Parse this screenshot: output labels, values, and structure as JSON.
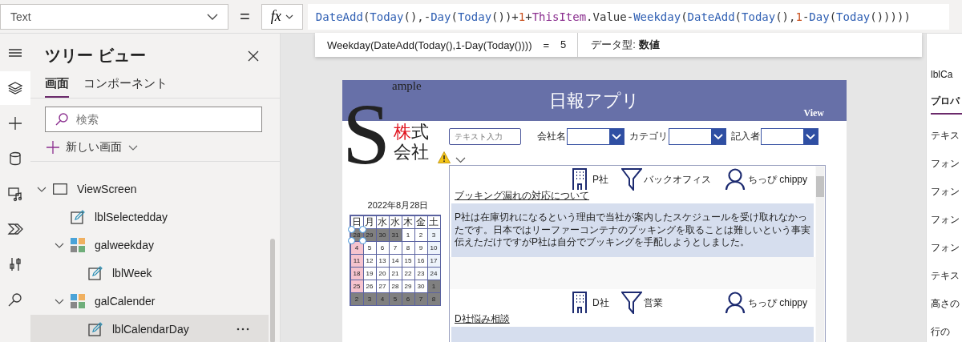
{
  "property_select": {
    "value": "Text"
  },
  "equals": "=",
  "fx_label": "fx",
  "formula": [
    {
      "kind": "function",
      "text": "DateAdd"
    },
    {
      "kind": "punct",
      "text": "("
    },
    {
      "kind": "function",
      "text": "Today"
    },
    {
      "kind": "punct",
      "text": "(),-"
    },
    {
      "kind": "function",
      "text": "Day"
    },
    {
      "kind": "punct",
      "text": "("
    },
    {
      "kind": "function",
      "text": "Today"
    },
    {
      "kind": "punct",
      "text": "())+"
    },
    {
      "kind": "number",
      "text": "1"
    },
    {
      "kind": "punct",
      "text": "+"
    },
    {
      "kind": "keyword",
      "text": "ThisItem"
    },
    {
      "kind": "punct",
      "text": ".Value-"
    },
    {
      "kind": "function",
      "text": "Weekday"
    },
    {
      "kind": "punct",
      "text": "("
    },
    {
      "kind": "function",
      "text": "DateAdd"
    },
    {
      "kind": "punct",
      "text": "("
    },
    {
      "kind": "function",
      "text": "Today"
    },
    {
      "kind": "punct",
      "text": "(),"
    },
    {
      "kind": "number",
      "text": "1"
    },
    {
      "kind": "punct",
      "text": "-"
    },
    {
      "kind": "function",
      "text": "Day"
    },
    {
      "kind": "punct",
      "text": "("
    },
    {
      "kind": "function",
      "text": "Today"
    },
    {
      "kind": "punct",
      "text": "()))))"
    }
  ],
  "formula_hint": {
    "expression": "Weekday(DateAdd(Today(),1-Day(Today())))",
    "equals": "=",
    "result": "5",
    "data_type": "データ型: **数値**"
  },
  "rail": [
    {
      "kind": "menu",
      "selected": false
    },
    {
      "kind": "layers",
      "selected": true
    },
    {
      "kind": "plus",
      "selected": false
    },
    {
      "kind": "database",
      "selected": false
    },
    {
      "kind": "media",
      "selected": false
    },
    {
      "kind": "flow",
      "selected": false
    },
    {
      "kind": "tools",
      "selected": false
    },
    {
      "kind": "search",
      "selected": false
    }
  ],
  "tree_panel": {
    "title": "ツリー ビュー",
    "tabs": [
      {
        "label": "画面",
        "selected": true
      },
      {
        "label": "コンポーネント",
        "selected": false
      }
    ],
    "search": {
      "placeholder": "検索"
    },
    "new_screen": "新しい画面",
    "items": [
      {
        "label": "ViewScreen",
        "kind": "screen",
        "expanded": true,
        "selected": false,
        "children": [
          {
            "label": "lblSelectedday",
            "kind": "label",
            "selected": false
          },
          {
            "label": "galweekday",
            "kind": "gallery",
            "expanded": true,
            "selected": false,
            "children": [
              {
                "label": "lblWeek",
                "kind": "label",
                "selected": false
              }
            ]
          },
          {
            "label": "galCalender",
            "kind": "gallery",
            "expanded": true,
            "selected": false,
            "children": [
              {
                "label": "lblCalendarDay",
                "kind": "label",
                "selected": true
              }
            ]
          }
        ]
      }
    ]
  },
  "app": {
    "title": "日報アプリ",
    "mode": "View",
    "logo": {
      "initial": "S",
      "word": "ample",
      "line1": [
        {
          "text": "株",
          "accent": true
        },
        {
          "text": "式",
          "accent": false
        }
      ],
      "line2": "会社"
    },
    "filters": {
      "text_placeholder": "テキスト入力",
      "dropdowns": [
        {
          "label": "会社名"
        },
        {
          "label": "カテゴリ"
        },
        {
          "label": "記入者"
        }
      ]
    },
    "calendar": {
      "date": "2022年8月28日",
      "weekdays": [
        "日",
        "月",
        "水",
        "水",
        "木",
        "金",
        "土"
      ],
      "weeks": [
        [
          {
            "day": "28",
            "kind": "other",
            "selected": true
          },
          {
            "day": "29",
            "kind": "other",
            "selected": false
          },
          {
            "day": "30",
            "kind": "other",
            "selected": false
          },
          {
            "day": "31",
            "kind": "other",
            "selected": false
          },
          {
            "day": "1",
            "kind": "normal",
            "selected": false
          },
          {
            "day": "2",
            "kind": "normal",
            "selected": false
          },
          {
            "day": "3",
            "kind": "saturday",
            "selected": false
          }
        ],
        [
          {
            "day": "4",
            "kind": "sunday",
            "selected": false
          },
          {
            "day": "5",
            "kind": "normal",
            "selected": false
          },
          {
            "day": "6",
            "kind": "normal",
            "selected": false
          },
          {
            "day": "7",
            "kind": "normal",
            "selected": false
          },
          {
            "day": "8",
            "kind": "normal",
            "selected": false
          },
          {
            "day": "9",
            "kind": "normal",
            "selected": false
          },
          {
            "day": "10",
            "kind": "saturday",
            "selected": false
          }
        ],
        [
          {
            "day": "11",
            "kind": "sunday",
            "selected": false
          },
          {
            "day": "12",
            "kind": "normal",
            "selected": false
          },
          {
            "day": "13",
            "kind": "normal",
            "selected": false
          },
          {
            "day": "14",
            "kind": "normal",
            "selected": false
          },
          {
            "day": "15",
            "kind": "normal",
            "selected": false
          },
          {
            "day": "16",
            "kind": "normal",
            "selected": false
          },
          {
            "day": "17",
            "kind": "saturday",
            "selected": false
          }
        ],
        [
          {
            "day": "18",
            "kind": "sunday",
            "selected": false
          },
          {
            "day": "19",
            "kind": "normal",
            "selected": false
          },
          {
            "day": "20",
            "kind": "normal",
            "selected": false
          },
          {
            "day": "21",
            "kind": "normal",
            "selected": false
          },
          {
            "day": "22",
            "kind": "normal",
            "selected": false
          },
          {
            "day": "23",
            "kind": "normal",
            "selected": false
          },
          {
            "day": "24",
            "kind": "saturday",
            "selected": false
          }
        ],
        [
          {
            "day": "25",
            "kind": "sunday",
            "selected": false
          },
          {
            "day": "26",
            "kind": "normal",
            "selected": false
          },
          {
            "day": "27",
            "kind": "normal",
            "selected": false
          },
          {
            "day": "28",
            "kind": "normal",
            "selected": false
          },
          {
            "day": "29",
            "kind": "normal",
            "selected": false
          },
          {
            "day": "30",
            "kind": "normal",
            "selected": false
          },
          {
            "day": "1",
            "kind": "other",
            "selected": false
          }
        ],
        [
          {
            "day": "2",
            "kind": "other",
            "selected": false
          },
          {
            "day": "3",
            "kind": "other",
            "selected": false
          },
          {
            "day": "4",
            "kind": "other",
            "selected": false
          },
          {
            "day": "5",
            "kind": "other",
            "selected": false
          },
          {
            "day": "6",
            "kind": "other",
            "selected": false
          },
          {
            "day": "7",
            "kind": "other",
            "selected": false
          },
          {
            "day": "8",
            "kind": "other",
            "selected": false
          }
        ]
      ]
    },
    "records": [
      {
        "title": "ブッキング漏れの対応について",
        "company": "P社",
        "category": "バックオフィス",
        "author": "ちっぴ chippy",
        "body": "P社は在庫切れになるという理由で当社が案内したスケジュールを受け取れなかったです。日本ではリーファーコンテナのブッキングを取ることは難しいという事実伝えただけですがP社は自分でブッキングを手配しようとしました。"
      },
      {
        "title": "D社悩み相談",
        "company": "D社",
        "category": "営業",
        "author": "ちっぴ chippy"
      }
    ]
  },
  "properties_panel": {
    "control": "lblCa",
    "tab": "プロパ",
    "rows": [
      "テキス",
      "フォン",
      "フォン",
      "フォン",
      "フォン",
      "テキス",
      "高さの",
      "行の"
    ]
  }
}
